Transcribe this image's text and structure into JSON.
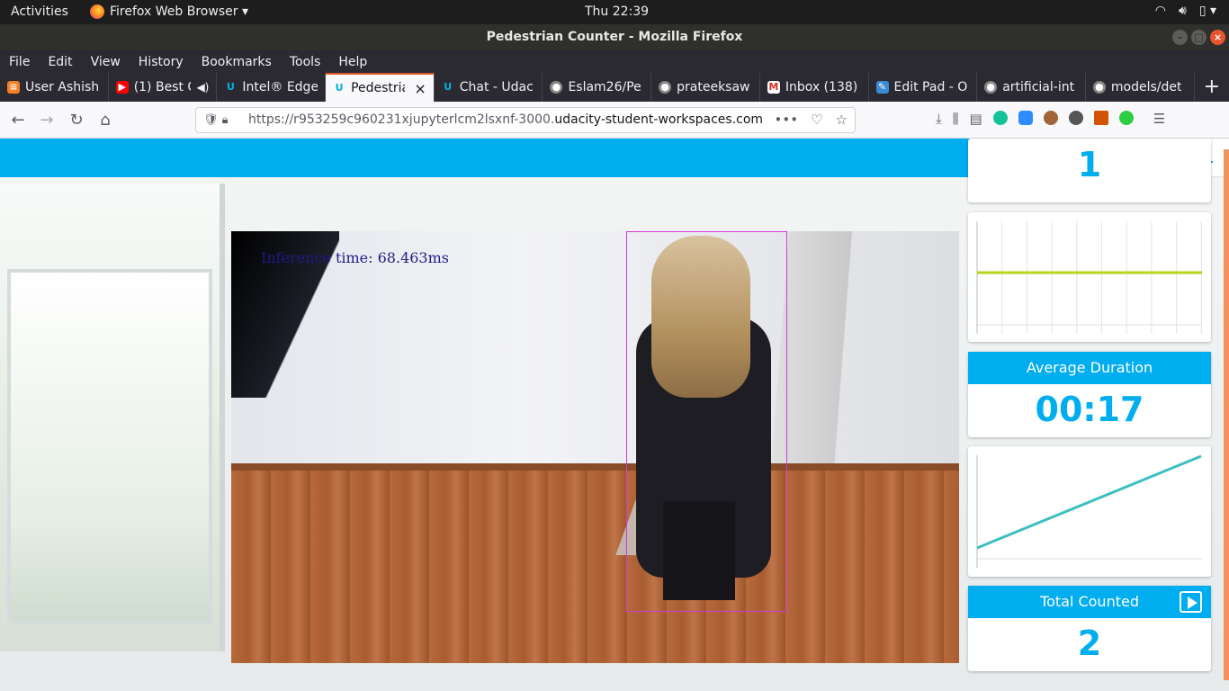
{
  "system_bar": {
    "activities": "Activities",
    "app_name": "Firefox Web Browser ▾",
    "clock": "Thu 22:39"
  },
  "window": {
    "title": "Pedestrian Counter - Mozilla Firefox"
  },
  "menu": [
    "File",
    "Edit",
    "View",
    "History",
    "Bookmarks",
    "Tools",
    "Help"
  ],
  "tabs": [
    {
      "label": "User Ashish",
      "icon": "stackoverflow-icon"
    },
    {
      "label": "(1) Best C",
      "icon": "youtube-icon"
    },
    {
      "label": "Intel® Edge",
      "icon": "udacity-icon"
    },
    {
      "label": "Pedestria",
      "icon": "udacity-icon"
    },
    {
      "label": "Chat - Udac",
      "icon": "udacity-icon"
    },
    {
      "label": "Eslam26/Pe",
      "icon": "github-icon"
    },
    {
      "label": "prateeksaw",
      "icon": "github-icon"
    },
    {
      "label": "Inbox (138)",
      "icon": "gmail-icon"
    },
    {
      "label": "Edit Pad - O",
      "icon": "editpad-icon"
    },
    {
      "label": "artificial-int",
      "icon": "github-icon"
    },
    {
      "label": "models/det",
      "icon": "github-icon"
    }
  ],
  "url": {
    "prefix": "https://r953259c960231xjupyterlcm2lsxnf-3000.",
    "domain": "udacity-student-workspaces.com"
  },
  "video": {
    "inference_text": "Inference time: 68.463ms"
  },
  "cards": {
    "current_count_value": "1",
    "average_duration": {
      "title": "Average Duration",
      "value": "00:17"
    },
    "total_counted": {
      "title": "Total Counted",
      "value": "2"
    }
  },
  "colors": {
    "accent": "#00adef",
    "count_line": "#b7d51c",
    "duration_line": "#3dbfbf",
    "bbox": "#d23adc"
  }
}
